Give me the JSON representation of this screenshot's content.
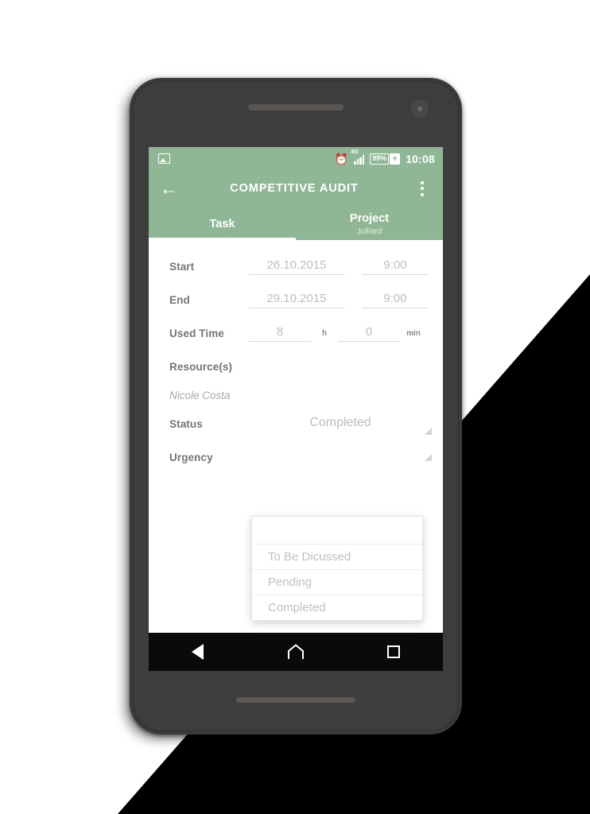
{
  "status_bar": {
    "image_icon": "image-icon",
    "alarm_icon": "⏰",
    "network_label": "4G",
    "battery_level": "99%",
    "battery_charging": "+",
    "time": "10:08"
  },
  "app_bar": {
    "back_label": "←",
    "title": "COMPETITIVE AUDIT",
    "overflow_label": "more-options"
  },
  "tabs": [
    {
      "label": "Task",
      "sub": "",
      "active": true
    },
    {
      "label": "Project",
      "sub": "Julliard",
      "active": false
    }
  ],
  "form": {
    "start": {
      "label": "Start",
      "date": "26.10.2015",
      "time": "9:00"
    },
    "end": {
      "label": "End",
      "date": "29.10.2015",
      "time": "9:00"
    },
    "used_time": {
      "label": "Used Time",
      "hours": "8",
      "hours_unit": "h",
      "minutes": "0",
      "minutes_unit": "min"
    },
    "resources": {
      "label": "Resource(s)",
      "value": "Nicole Costa"
    },
    "status": {
      "label": "Status",
      "value": "Completed"
    },
    "urgency": {
      "label": "Urgency",
      "value": ""
    }
  },
  "dropdown": {
    "items": [
      {
        "label": ""
      },
      {
        "label": "To Be Dicussed"
      },
      {
        "label": "Pending"
      },
      {
        "label": "Completed"
      }
    ]
  },
  "nav_bar": {
    "back": "back-icon",
    "home": "home-icon",
    "recents": "recents-icon"
  },
  "colors": {
    "accent_green": "#8fb795",
    "device_body": "#3a3a3a",
    "nav_bar": "#0a0a0a",
    "label_gray": "#757575",
    "value_gray": "#bdbdbd"
  }
}
